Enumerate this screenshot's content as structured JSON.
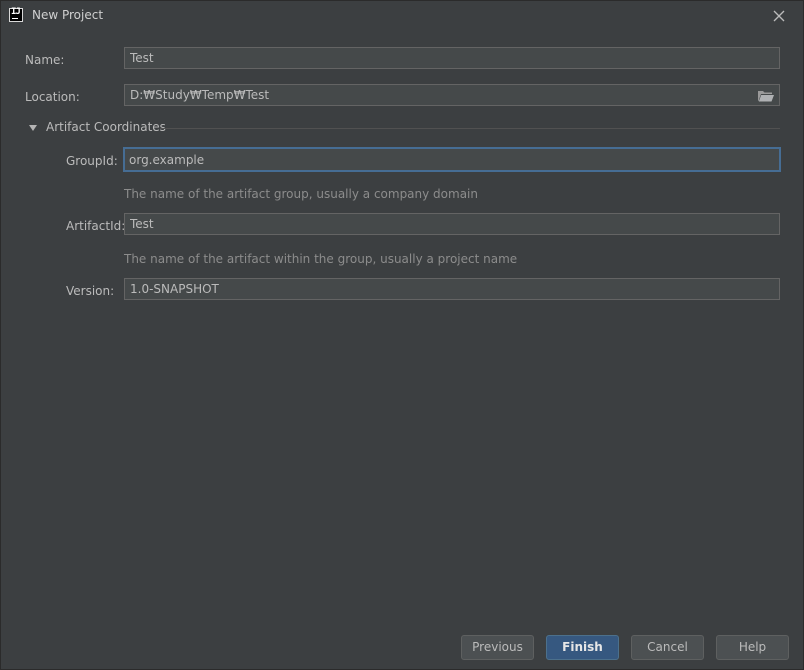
{
  "window": {
    "title": "New Project",
    "icon": "intellij-idea-icon",
    "icon_text": "IJ"
  },
  "form": {
    "name": {
      "label": "Name:",
      "value": "Test"
    },
    "location": {
      "label": "Location:",
      "value": "D:₩Study₩Temp₩Test"
    }
  },
  "artifact": {
    "section_title": "Artifact Coordinates",
    "expanded": true,
    "group_id": {
      "label": "GroupId:",
      "value": "org.example",
      "hint": "The name of the artifact group, usually a company domain"
    },
    "artifact_id": {
      "label": "ArtifactId:",
      "value": "Test",
      "hint": "The name of the artifact within the group, usually a project name"
    },
    "version": {
      "label": "Version:",
      "value": "1.0-SNAPSHOT"
    }
  },
  "buttons": {
    "previous": "Previous",
    "finish": "Finish",
    "cancel": "Cancel",
    "help": "Help"
  },
  "colors": {
    "background": "#3c3f41",
    "field_bg": "#45494a",
    "focus_border": "#466d94",
    "primary_button": "#365880"
  }
}
